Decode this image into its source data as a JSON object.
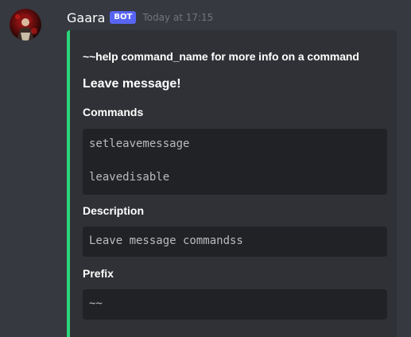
{
  "message": {
    "username": "Gaara",
    "bot_tag": "BOT",
    "timestamp": "Today at 17:15",
    "avatar_icon": "gaara-avatar-icon"
  },
  "embed": {
    "accent_color": "#2bd67b",
    "author": "~~help command_name for more info on a command",
    "title": "Leave message!",
    "fields": [
      {
        "name": "Commands",
        "lines": [
          "setleavemessage",
          "leavedisable"
        ]
      },
      {
        "name": "Description",
        "lines": [
          "Leave message commandss"
        ]
      },
      {
        "name": "Prefix",
        "lines": [
          "~~"
        ]
      }
    ]
  }
}
